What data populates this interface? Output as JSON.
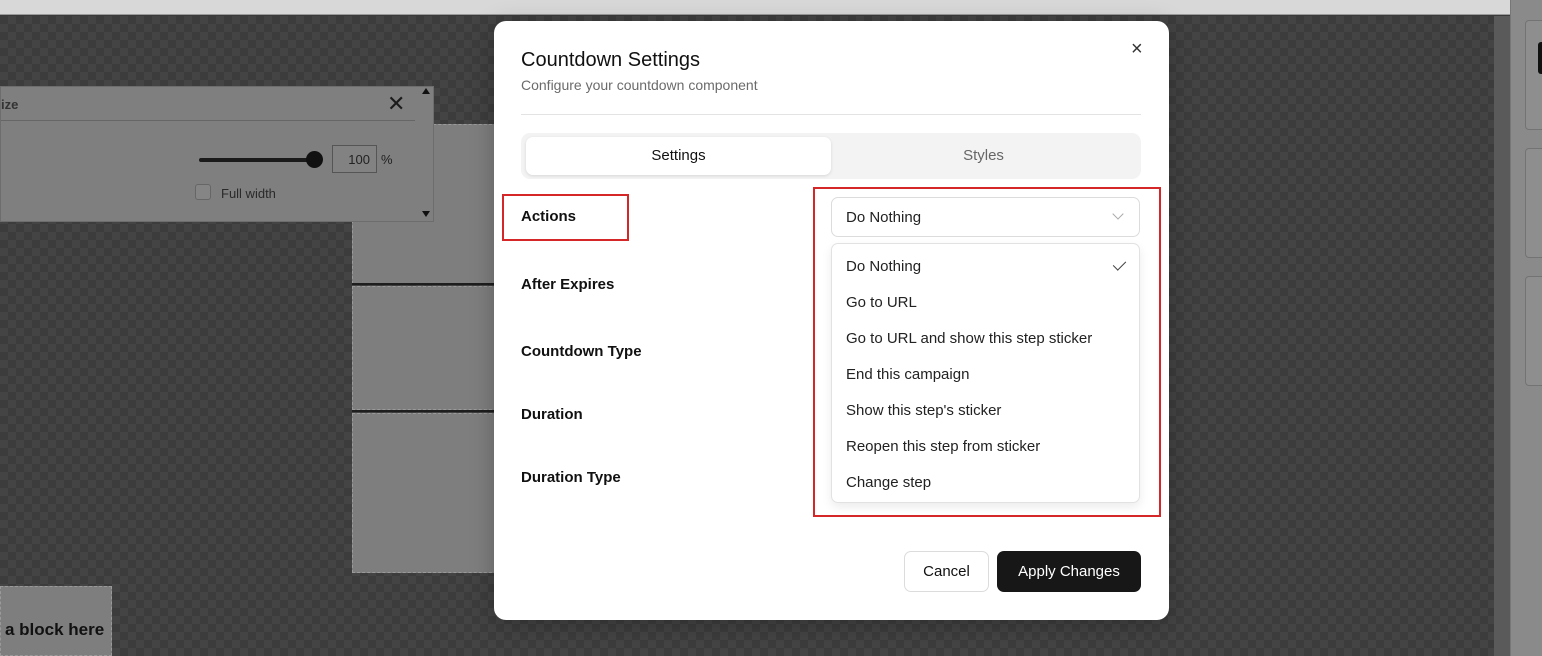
{
  "background": {
    "size_panel": {
      "title": "ize",
      "width_value": "100",
      "unit": "%",
      "full_width_label": "Full width",
      "full_width_checked": false,
      "slider_percent": 100
    },
    "drop_hint": "a block here"
  },
  "modal": {
    "title": "Countdown Settings",
    "subtitle": "Configure your countdown component",
    "close_glyph": "×",
    "tabs": [
      {
        "label": "Settings",
        "active": true
      },
      {
        "label": "Styles",
        "active": false
      }
    ],
    "fields": [
      {
        "label": "Actions"
      },
      {
        "label": "After Expires"
      },
      {
        "label": "Countdown Type"
      },
      {
        "label": "Duration"
      },
      {
        "label": "Duration Type"
      }
    ],
    "actions_select": {
      "value": "Do Nothing",
      "options": [
        {
          "label": "Do Nothing",
          "selected": true
        },
        {
          "label": "Go to URL",
          "selected": false
        },
        {
          "label": "Go to URL and show this step sticker",
          "selected": false
        },
        {
          "label": "End this campaign",
          "selected": false
        },
        {
          "label": "Show this step's sticker",
          "selected": false
        },
        {
          "label": "Reopen this step from sticker",
          "selected": false
        },
        {
          "label": "Change step",
          "selected": false
        }
      ]
    },
    "buttons": {
      "cancel": "Cancel",
      "apply": "Apply Changes"
    }
  },
  "colors": {
    "highlight": "#d62728",
    "primary_button": "#171717",
    "overlay": "#3a3a3a"
  }
}
